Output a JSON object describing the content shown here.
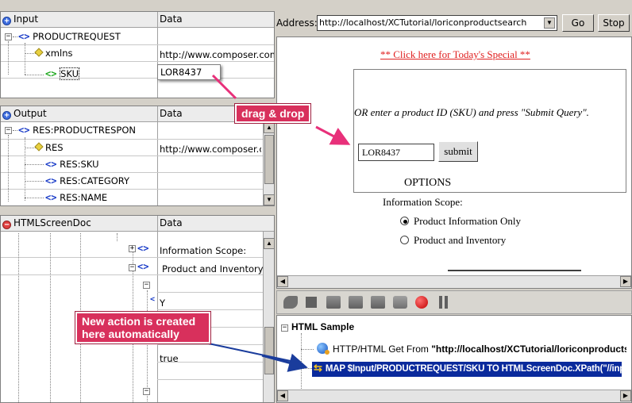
{
  "input_panel": {
    "col1": "Input",
    "col2": "Data",
    "rows": [
      {
        "name": "PRODUCTREQUEST",
        "value": ""
      },
      {
        "name": "xmlns",
        "value": "http://www.composer.com/"
      },
      {
        "name": "SKU",
        "value": "LOR8437"
      }
    ]
  },
  "output_panel": {
    "col1": "Output",
    "col2": "Data",
    "rows": [
      {
        "name": "RES:PRODUCTRESPON",
        "value": ""
      },
      {
        "name": "RES",
        "value": "http://www.composer.co"
      },
      {
        "name": "RES:SKU",
        "value": ""
      },
      {
        "name": "RES:CATEGORY",
        "value": ""
      },
      {
        "name": "RES:NAME",
        "value": ""
      }
    ]
  },
  "html_panel": {
    "col1": "HTMLScreenDoc",
    "col2": "Data",
    "values": [
      "Information Scope:",
      "Product and Inventory",
      "Y",
      "true"
    ]
  },
  "browser": {
    "address_label": "Address:",
    "address_value": "http://localhost/XCTutorial/loriconproductsearch",
    "go_label": "Go",
    "stop_label": "Stop",
    "special_link": "** Click here for Today's Special **",
    "prompt": "OR enter a product ID (SKU) and press \"Submit Query\".",
    "sku_value": "LOR8437",
    "submit_label": "submit",
    "options_heading": "OPTIONS",
    "scope_label": "Information Scope:",
    "radio_options": [
      {
        "label": "Product Information Only",
        "selected": true
      },
      {
        "label": "Product and Inventory",
        "selected": false
      }
    ]
  },
  "actions": {
    "root_label": "HTML Sample",
    "items": [
      {
        "prefix": "HTTP/HTML Get From ",
        "target": "\"http://localhost/XCTutorial/loriconproductse"
      },
      {
        "text": "MAP $Input/PRODUCTREQUEST/SKU TO HTMLScreenDoc.XPath(\"//inp"
      }
    ]
  },
  "callouts": {
    "drag_drop": "drag & drop",
    "new_action_line1": "New action is created",
    "new_action_line2": "here automatically"
  },
  "colors": {
    "callout": "#d8305c",
    "selection": "#0a2a9c",
    "link": "#e02020"
  }
}
